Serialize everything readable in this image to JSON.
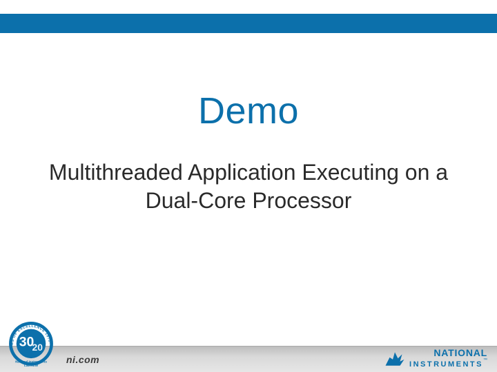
{
  "colors": {
    "accent": "#0c70ab",
    "text": "#2a2a2a"
  },
  "slide": {
    "title": "Demo",
    "subtitle": "Multithreaded Application Executing on a Dual-Core Processor"
  },
  "footer": {
    "url": "ni.com",
    "seal": {
      "top_arc": "YEARS OF EXCELLENCE 1976-2006",
      "big_number": "30",
      "small_number": "20",
      "bottom_label": "National Instruments",
      "bottom_sub": "LabVIEW"
    },
    "logo": {
      "line1": "NATIONAL",
      "line2": "INSTRUMENTS",
      "tm": "™",
      "icon": "ni-eagle-icon"
    }
  }
}
